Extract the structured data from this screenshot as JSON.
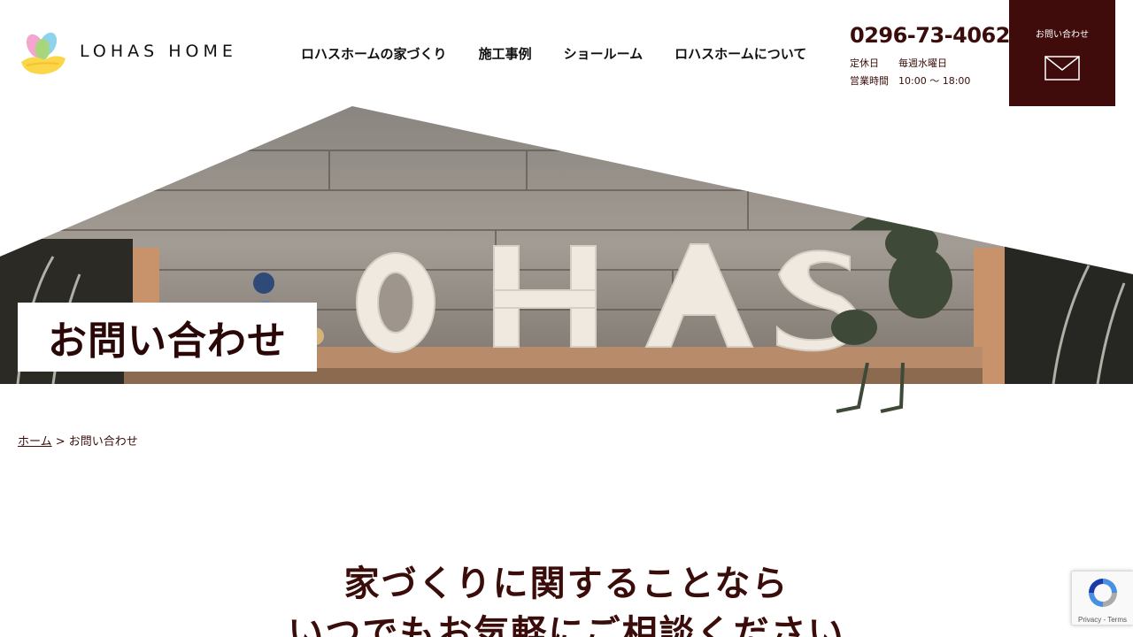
{
  "header": {
    "logo_text": "LOHAS HOME",
    "nav": [
      {
        "label": "ロハスホームの家づくり"
      },
      {
        "label": "施工事例"
      },
      {
        "label": "ショールーム"
      },
      {
        "label": "ロハスホームについて"
      }
    ],
    "phone": "0296-73-4062",
    "closed_label": "定休日",
    "closed_value": "毎週水曜日",
    "hours_label": "営業時間",
    "hours_value": "10:00 〜 18:00",
    "contact_button_label": "お問い合わせ"
  },
  "hero": {
    "title": "お問い合わせ"
  },
  "breadcrumb": {
    "home": "ホーム",
    "separator": " > ",
    "current": "お問い合わせ"
  },
  "lead": {
    "line1": "家づくりに関することなら",
    "line2": "いつでもお気軽にご相談ください"
  },
  "recaptcha": {
    "links": "Privacy - Terms"
  },
  "colors": {
    "brand_dark": "#3f0c0b",
    "text": "#3a0d0a"
  }
}
